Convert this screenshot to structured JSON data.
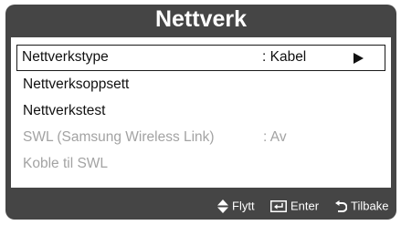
{
  "title": "Nettverk",
  "menu": {
    "items": [
      {
        "label": "Nettverkstype",
        "value": ": Kabel"
      },
      {
        "label": "Nettverksoppsett",
        "value": ""
      },
      {
        "label": "Nettverkstest",
        "value": ""
      },
      {
        "label": "SWL (Samsung Wireless Link)",
        "value": ": Av"
      },
      {
        "label": "Koble til SWL",
        "value": ""
      }
    ]
  },
  "footer": {
    "move": "Flytt",
    "enter": "Enter",
    "back": "Tilbake"
  },
  "icons": {
    "move": "up-down-arrows-icon",
    "enter": "enter-icon",
    "back": "return-icon",
    "submenu": "triangle-right-icon"
  },
  "colors": {
    "panel": "#454545",
    "text": "#111111",
    "disabled_text": "#a3a3a3"
  }
}
